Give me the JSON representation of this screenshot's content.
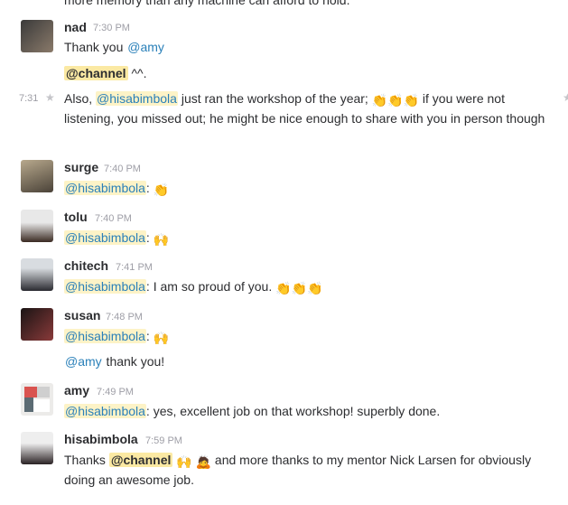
{
  "top_fragment": "more memory than any machine can afford to hold.",
  "messages": [
    {
      "user": "nad",
      "time": "7:30 PM",
      "l1_text": "Thank you ",
      "l1_mention": "@amy",
      "l2_channel": "@channel",
      "l2_rest": " ^^.",
      "follow_time": "7:31",
      "l3_pre": "Also, ",
      "l3_mention": "@hisabimbola",
      "l3_mid": " just ran the workshop of the year; ",
      "l3_post": " if you were not listening, you missed out; he might be nice enough to share with you in person though",
      "emoji": "clap-emoji"
    },
    {
      "user": "surge",
      "time": "7:40 PM",
      "mention": "@hisabimbola",
      "text": ": ",
      "emoji": "clap-emoji"
    },
    {
      "user": "tolu",
      "time": "7:40 PM",
      "mention": "@hisabimbola",
      "text": ": ",
      "emoji": "raised-hands-emoji"
    },
    {
      "user": "chitech",
      "time": "7:41 PM",
      "mention": "@hisabimbola",
      "text": ": I am so proud of you. ",
      "emoji": "clap-emoji"
    },
    {
      "user": "susan",
      "time": "7:48 PM",
      "mention": "@hisabimbola",
      "text": ": ",
      "emoji": "raised-hands-emoji",
      "l2_mention": "@amy",
      "l2_text": " thank you!"
    },
    {
      "user": "amy",
      "time": "7:49 PM",
      "mention": "@hisabimbola",
      "text": ": yes, excellent job on that workshop! superbly done."
    },
    {
      "user": "hisabimbola",
      "time": "7:59 PM",
      "pre": "Thanks ",
      "channel": "@channel",
      "post": " and more thanks to my mentor Nick Larsen for obviously doing an awesome job.",
      "emoji": "raised-hands-emoji",
      "emoji2": "bowing-emoji"
    }
  ],
  "emoji_glyphs": {
    "clap": "👏",
    "hands": "🙌",
    "bow": "🙇"
  },
  "colors": {
    "mention": "#2a80b9",
    "mention_bg": "#fdf3c7",
    "channel_bg": "#fbe9a3",
    "time": "#9e9ea6"
  }
}
